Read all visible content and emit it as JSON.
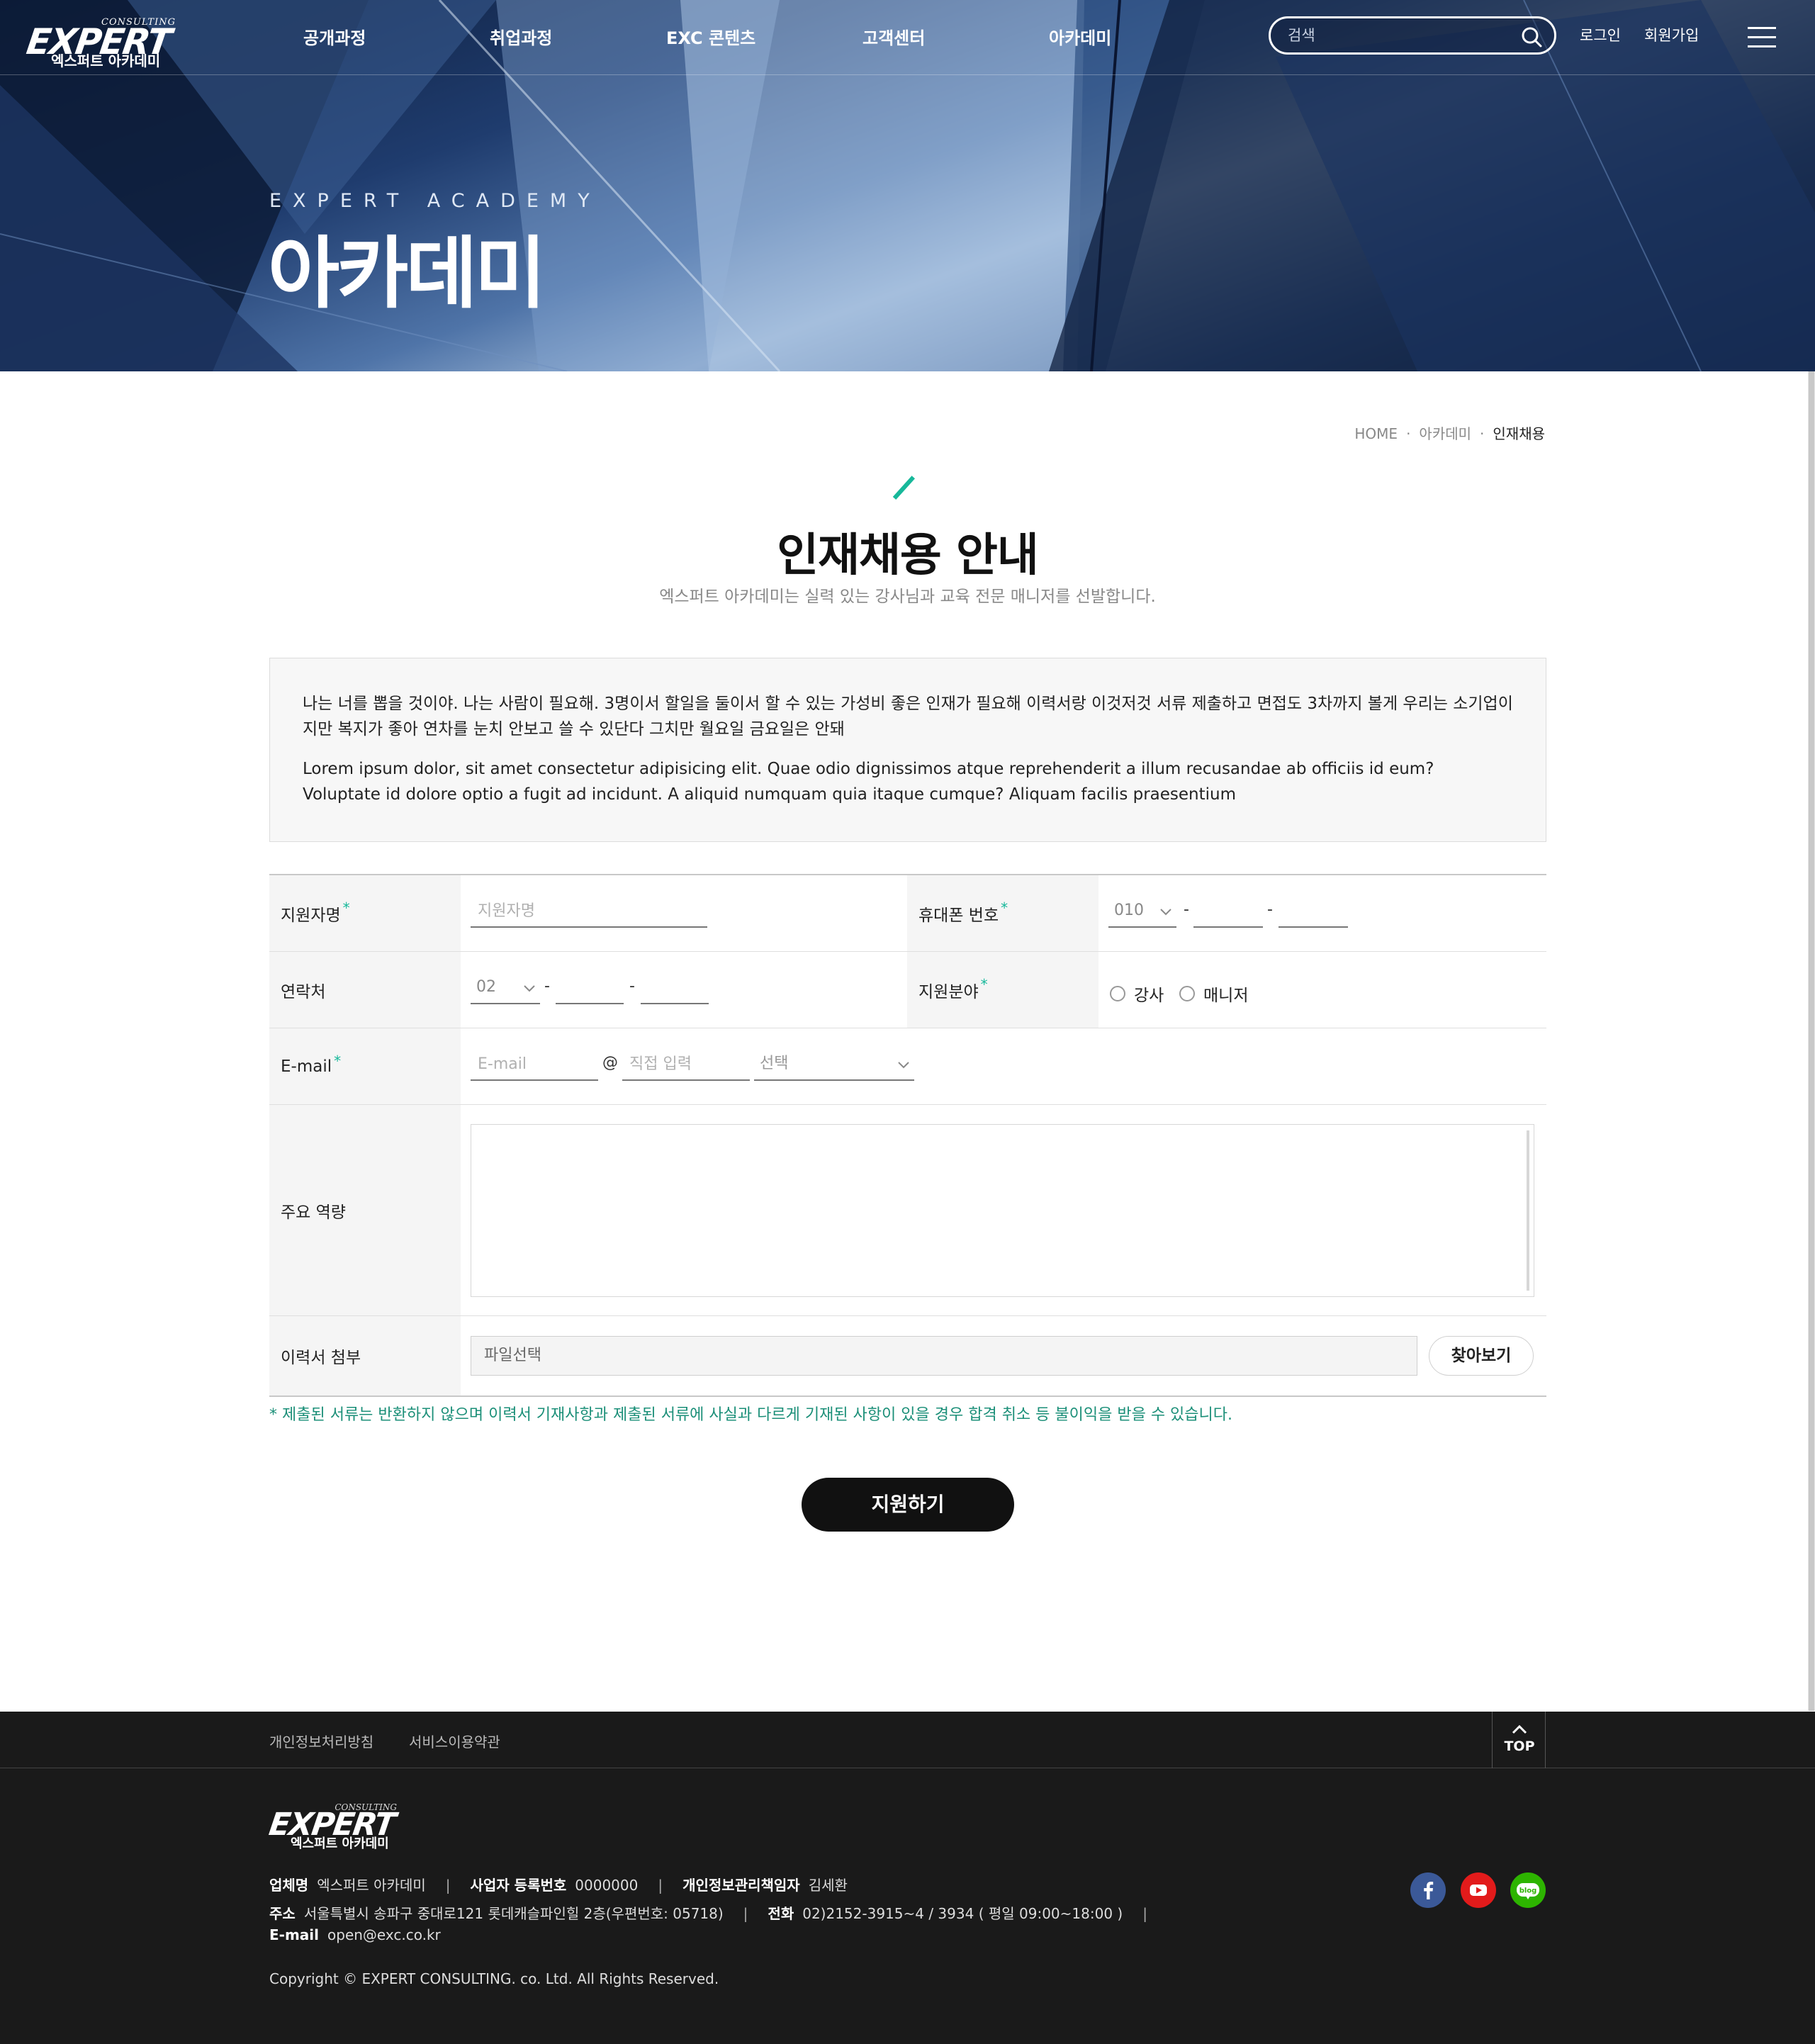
{
  "header": {
    "logo": {
      "main": "EXPERT",
      "sub": "CONSULTING",
      "kor": "엑스퍼트 아카데미"
    },
    "nav": [
      "공개과정",
      "취업과정",
      "EXC 콘텐츠",
      "고객센터",
      "아카데미"
    ],
    "search_placeholder": "검색",
    "login": "로그인",
    "signup": "회원가입"
  },
  "hero": {
    "subtitle": "EXPERT ACADEMY",
    "title": "아카데미"
  },
  "breadcrumb": [
    "HOME",
    "아카데미",
    "인재채용"
  ],
  "page": {
    "title": "인재채용 안내",
    "description": "엑스퍼트 아카데미는 실력 있는 강사님과 교육 전문 매니저를 선발합니다."
  },
  "intro": {
    "paragraph1": "나는 너를 뽑을 것이야. 나는 사람이 필요해. 3명이서 할일을 둘이서 할 수 있는 가성비 좋은 인재가 필요해 이력서랑 이것저것 서류 제출하고 면접도 3차까지 볼게 우리는 소기업이지만 복지가 좋아 연차를 눈치 안보고 쓸 수 있단다 그치만 월요일 금요일은 안돼",
    "paragraph2": "Lorem ipsum dolor, sit amet consectetur adipisicing elit. Quae odio dignissimos atque reprehenderit a illum recusandae ab officiis id eum? Voluptate id dolore optio a fugit ad incidunt. A aliquid numquam quia itaque cumque? Aliquam facilis praesentium"
  },
  "form": {
    "name_label": "지원자명",
    "name_placeholder": "지원자명",
    "phone_label": "휴대폰 번호",
    "phone_prefix": "010",
    "contact_label": "연락처",
    "contact_prefix": "02",
    "dash": "-",
    "field_label": "지원분야",
    "field_options": [
      "강사",
      "매니저"
    ],
    "email_label": "E-mail",
    "email_placeholder": "E-mail",
    "at": "@",
    "domain_placeholder": "직접 입력",
    "domain_select": "선택",
    "skills_label": "주요 역량",
    "resume_label": "이력서 첨부",
    "file_placeholder": "파일선택",
    "find_button": "찾아보기",
    "required_mark": "*"
  },
  "notice": "* 제출된 서류는 반환하지 않으며 이력서 기재사항과 제출된 서류에 사실과 다르게 기재된 사항이 있을 경우 합격 취소 등 불이익을 받을 수 있습니다.",
  "submit_label": "지원하기",
  "footer": {
    "links": [
      "개인정보처리방침",
      "서비스이용약관"
    ],
    "top_label": "TOP",
    "company_label": "업체명",
    "company": "엑스퍼트 아카데미",
    "reg_label": "사업자 등록번호",
    "reg": "0000000",
    "privacy_label": "개인정보관리책임자",
    "privacy": "김세환",
    "address_label": "주소",
    "address": "서울특별시 송파구 중대로121 롯데캐슬파인힐 2층(우편번호: 05718)",
    "phone_label": "전화",
    "phone": "02)2152-3915~4 / 3934 ( 평일 09:00~18:00 )",
    "email_label": "E-mail",
    "email": "open@exc.co.kr",
    "copyright": "Copyright © EXPERT CONSULTING. co. Ltd. All Rights Reserved.",
    "blog_text": "blog"
  },
  "colors": {
    "accent": "#17b89a",
    "notice": "#1b8f78",
    "footer_bg": "#1a1a1a",
    "facebook": "#3b5998",
    "youtube": "#e21b1b",
    "blog": "#2db400"
  }
}
